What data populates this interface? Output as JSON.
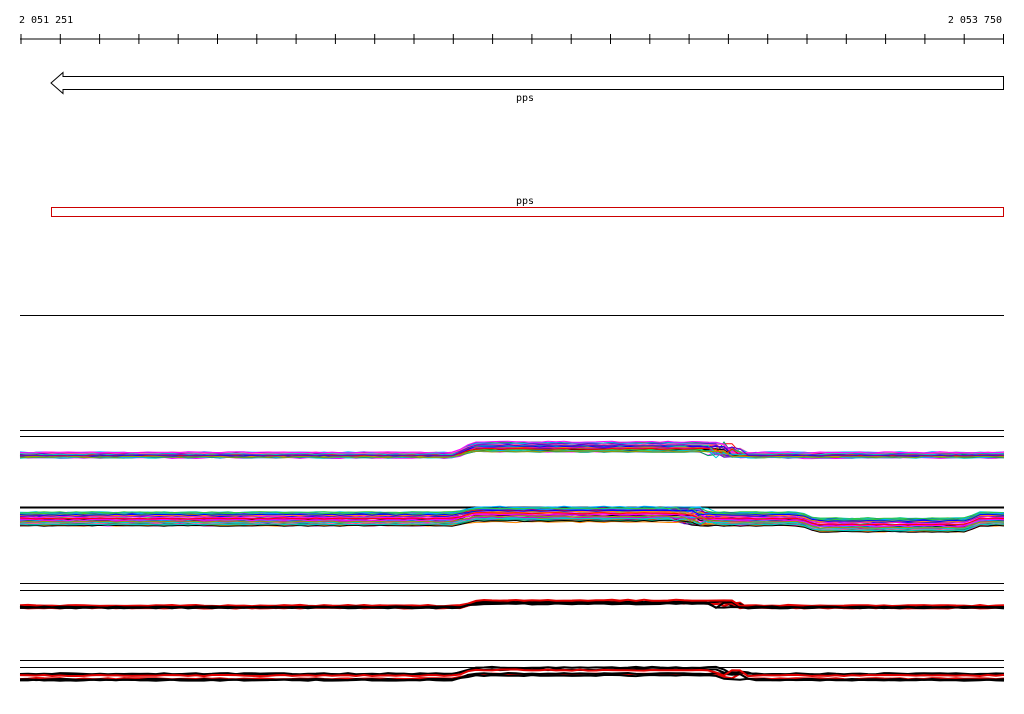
{
  "ruler": {
    "start_label": "2 051 251",
    "end_label": "2 053 750"
  },
  "gene_track": {
    "gene_label": "pps",
    "strand": "minus"
  },
  "feature_track": {
    "feature_label": "pps",
    "feature_color": "#cc0000"
  },
  "colors": {
    "axis": "#000000",
    "feature_outline": "#cc0000",
    "series_red": "#e00000",
    "series_black": "#000000",
    "rainbow": [
      "#ff00ff",
      "#00aaff",
      "#33cc33",
      "#ff8800",
      "#cc00cc",
      "#0000ff",
      "#ff0000",
      "#00cccc",
      "#999900",
      "#6600cc",
      "#ff66aa",
      "#009966"
    ]
  }
}
